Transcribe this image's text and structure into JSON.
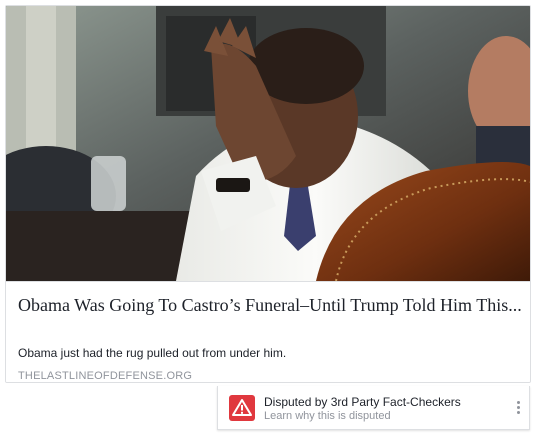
{
  "link_preview": {
    "image": {
      "alt": "man covering his face with his hand",
      "palette": {
        "background": "#4a5058",
        "wall": "#c9ccc3",
        "skin": "#6b4532",
        "shirt": "#f4f4f2",
        "chair": "#7a3a16",
        "dark": "#1b1714"
      }
    },
    "headline": "Obama Was Going To Castro’s Funeral–Until Trump Told Him This...",
    "subtitle": "Obama just had the rug pulled out from under him.",
    "domain": "THELASTLINEOFDEFENSE.ORG"
  },
  "dispute_banner": {
    "icon": "warning-triangle-icon",
    "accent_color": "#e0383e",
    "title": "Disputed by 3rd Party Fact-Checkers",
    "link": "Learn why this is disputed",
    "menu_icon": "vertical-ellipsis-icon"
  }
}
